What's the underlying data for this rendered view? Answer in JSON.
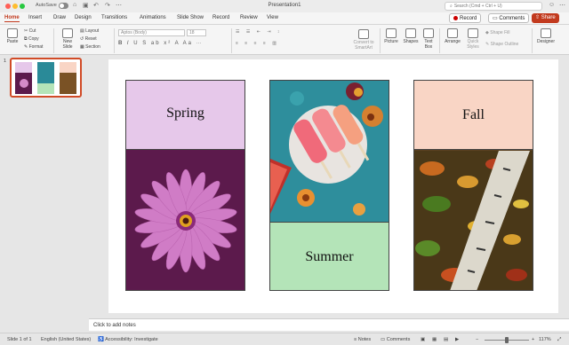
{
  "titlebar": {
    "autosave_label": "AutoSave",
    "title": "Presentation1",
    "search_placeholder": "Search (Cmd + Ctrl + U)"
  },
  "tabs": [
    "Home",
    "Insert",
    "Draw",
    "Design",
    "Transitions",
    "Animations",
    "Slide Show",
    "Record",
    "Review",
    "View"
  ],
  "actions": {
    "record": "Record",
    "comments": "Comments",
    "share": "Share"
  },
  "ribbon": {
    "paste": "Paste",
    "cut": "Cut",
    "copy": "Copy",
    "format": "Format",
    "new_slide": "New Slide",
    "layout": "Layout",
    "reset": "Reset",
    "section": "Section",
    "font_name": "Aptos (Body)",
    "font_size": "18",
    "convert_smartart": "Convert to SmartArt",
    "picture": "Picture",
    "shapes": "Shapes",
    "text_box": "Text Box",
    "arrange": "Arrange",
    "quick_styles": "Quick Styles",
    "shape_fill": "Shape Fill",
    "shape_outline": "Shape Outline",
    "designer": "Designer"
  },
  "thumbnails": {
    "slide_number": "1"
  },
  "slide": {
    "panels": [
      {
        "label": "Spring",
        "label_bg": "#e6c8ea",
        "image_bg": "#5c1a4c",
        "image_desc": "pink daisy"
      },
      {
        "label": "Summer",
        "label_bg": "#b4e4b8",
        "image_bg": "#2a8a98",
        "image_desc": "popsicles"
      },
      {
        "label": "Fall",
        "label_bg": "#f9d5c5",
        "image_bg": "#5a4020",
        "image_desc": "autumn leaves"
      }
    ]
  },
  "notes": {
    "placeholder": "Click to add notes"
  },
  "status": {
    "slide_of": "Slide 1 of 1",
    "language": "English (United States)",
    "accessibility": "Accessibility: Investigate",
    "notes": "Notes",
    "comments": "Comments",
    "zoom": "117%"
  },
  "colors": {
    "accent": "#c23a1e"
  }
}
